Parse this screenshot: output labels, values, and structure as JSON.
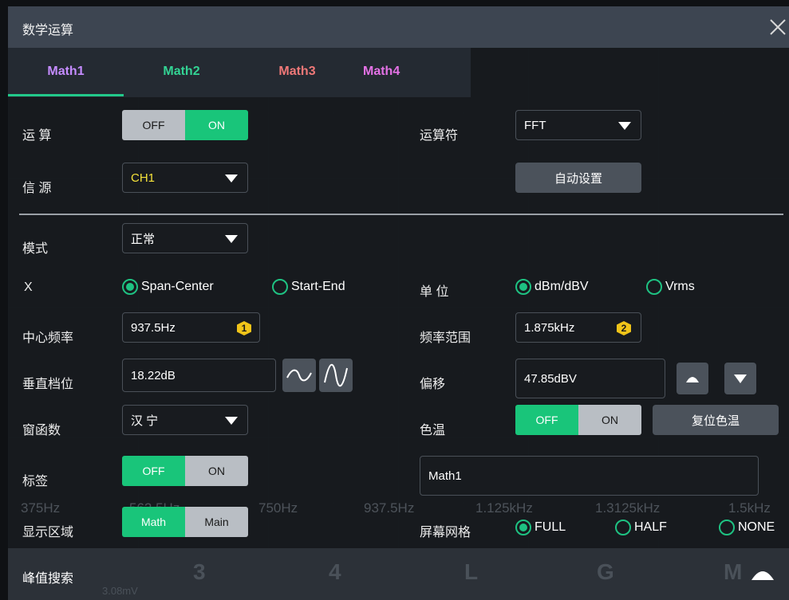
{
  "dialog": {
    "title": "数学运算"
  },
  "tabs": [
    {
      "label": "Math1",
      "color": "#c58cff",
      "active": true
    },
    {
      "label": "Math2",
      "color": "#33d394"
    },
    {
      "label": "Math3",
      "color": "#f07878"
    },
    {
      "label": "Math4",
      "color": "#e472e6"
    }
  ],
  "labels": {
    "operation": "运 算",
    "source": "信 源",
    "operator": "运算符",
    "mode": "模式",
    "x": "X",
    "center_freq": "中心频率",
    "vertical_scale": "垂直档位",
    "window": "窗函数",
    "tag": "标签",
    "display_area": "显示区域",
    "unit": "单 位",
    "freq_range": "频率范围",
    "offset": "偏移",
    "color_temp": "色温",
    "screen_grid": "屏幕网格"
  },
  "operation_toggle": {
    "off": "OFF",
    "on": "ON",
    "state": "on"
  },
  "operator_select": {
    "value": "FFT"
  },
  "source_select": {
    "value": "CH1",
    "color": "#f5e23a"
  },
  "auto_setup_button": "自动设置",
  "mode_select": {
    "value": "正常"
  },
  "x_radios": [
    {
      "label": "Span-Center",
      "selected": true
    },
    {
      "label": "Start-End",
      "selected": false
    }
  ],
  "unit_radios": [
    {
      "label": "dBm/dBV",
      "selected": true
    },
    {
      "label": "Vrms",
      "selected": false
    }
  ],
  "center_freq": {
    "value": "937.5Hz",
    "badge": "1"
  },
  "freq_range": {
    "value": "1.875kHz",
    "badge": "2"
  },
  "vertical_scale": {
    "value": "18.22dB"
  },
  "offset": {
    "value": "47.85dBV"
  },
  "window_select": {
    "value": "汉 宁"
  },
  "color_temp_toggle": {
    "off": "OFF",
    "on": "ON",
    "state": "off"
  },
  "reset_color_temp_button": "复位色温",
  "tag_toggle": {
    "off": "OFF",
    "on": "ON",
    "state": "off"
  },
  "tag_input": {
    "value": "Math1"
  },
  "display_area_toggle": {
    "math": "Math",
    "main": "Main",
    "state": "math"
  },
  "grid_radios": [
    {
      "label": "FULL",
      "selected": true
    },
    {
      "label": "HALF",
      "selected": false
    },
    {
      "label": "NONE",
      "selected": false
    }
  ],
  "freq_axis": [
    "375Hz",
    "562.5Hz",
    "750Hz",
    "937.5Hz",
    "1.125kHz",
    "1.3125kHz",
    "1.5kHz"
  ],
  "peak_search": {
    "label": "峰值搜索"
  },
  "background": {
    "ch3": "3",
    "ch4": "4",
    "l": "L",
    "g": "G",
    "m": "M",
    "reading": "3.08mV"
  },
  "icons": [
    "close-icon",
    "caret-down-icon",
    "wave-fine-icon",
    "wave-coarse-icon",
    "arrow-up-icon",
    "arrow-down-icon",
    "expand-up-icon"
  ]
}
